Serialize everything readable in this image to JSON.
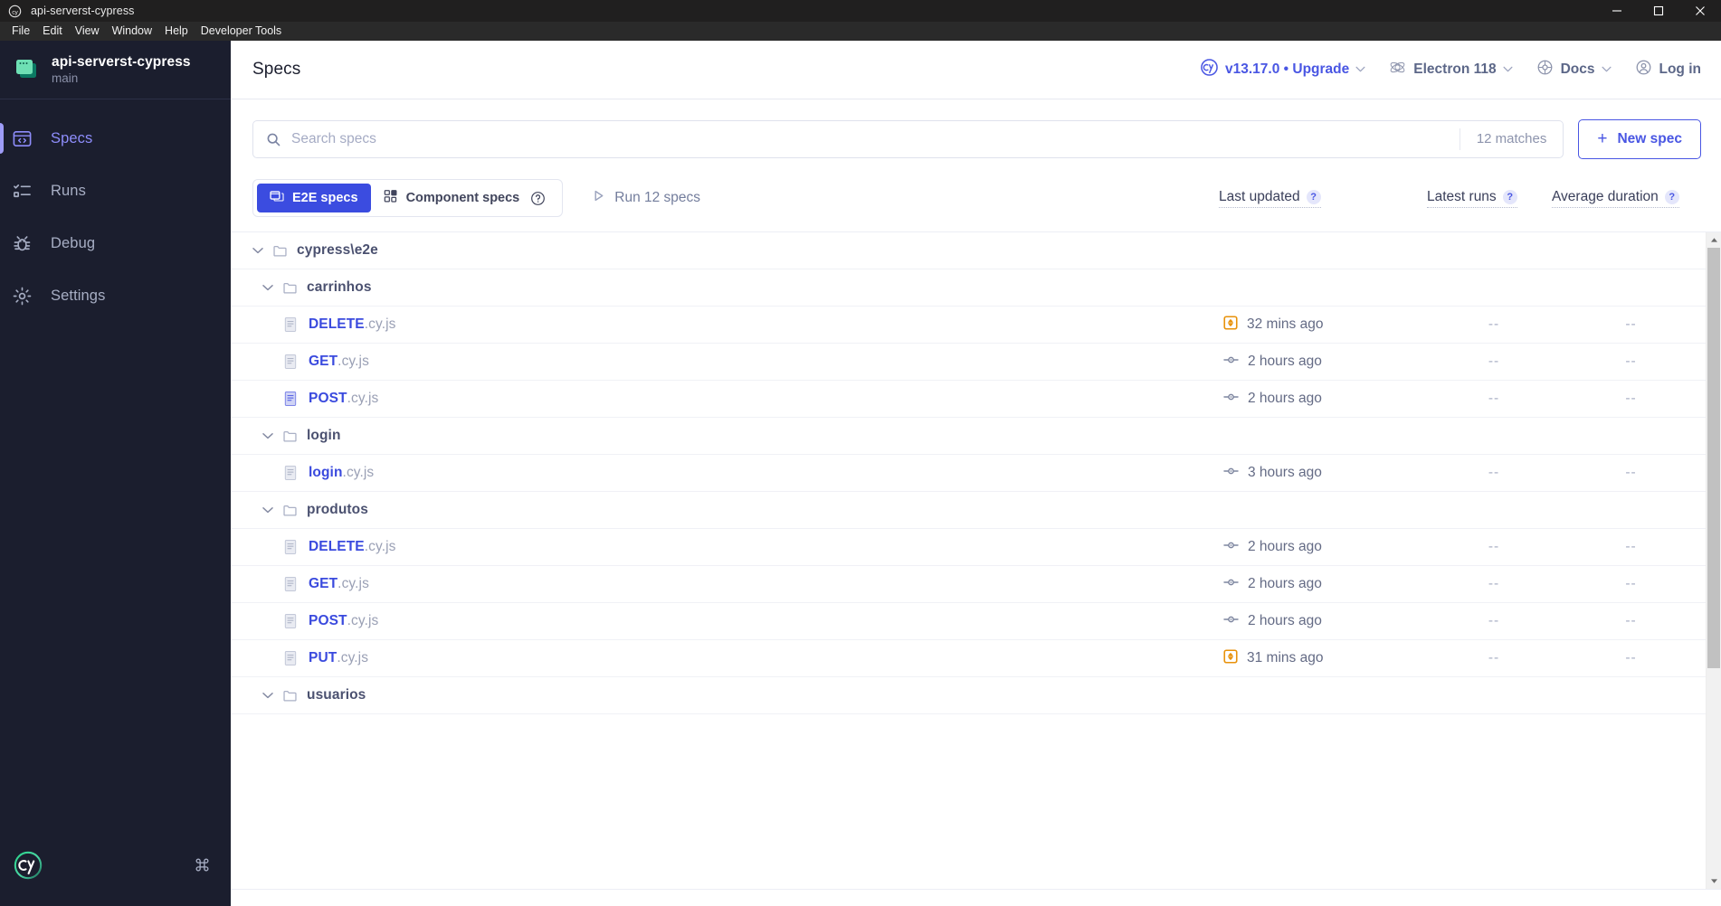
{
  "window": {
    "title": "api-serverst-cypress",
    "logo_icon": "cypress-logo-icon",
    "controls": [
      {
        "name": "minimize-button",
        "icon": "minimize-icon"
      },
      {
        "name": "maximize-button",
        "icon": "maximize-icon"
      },
      {
        "name": "close-button",
        "icon": "close-icon"
      }
    ]
  },
  "menubar": {
    "items": [
      {
        "label": "File"
      },
      {
        "label": "Edit"
      },
      {
        "label": "View"
      },
      {
        "label": "Window"
      },
      {
        "label": "Help"
      },
      {
        "label": "Developer Tools"
      }
    ]
  },
  "sidebar": {
    "project": {
      "name": "api-serverst-cypress",
      "branch": "main",
      "icon": "project-window-icon"
    },
    "items": [
      {
        "label": "Specs",
        "icon": "specs-code-window-icon",
        "active": true
      },
      {
        "label": "Runs",
        "icon": "runs-list-icon",
        "active": false
      },
      {
        "label": "Debug",
        "icon": "debug-bug-icon",
        "active": false
      },
      {
        "label": "Settings",
        "icon": "settings-gear-icon",
        "active": false
      }
    ],
    "footer": {
      "logo_icon": "cypress-cy-logo-icon",
      "shortcut_icon": "keyboard-command-icon"
    }
  },
  "header": {
    "title": "Specs",
    "links": [
      {
        "name": "version-upgrade",
        "icon": "cypress-badge-icon",
        "text": "v13.17.0 • Upgrade",
        "chevron": true,
        "accent": true
      },
      {
        "name": "browser-selector",
        "icon": "electron-icon",
        "text": "Electron 118",
        "chevron": true,
        "accent": false
      },
      {
        "name": "docs-menu",
        "icon": "docs-book-icon",
        "text": "Docs",
        "chevron": true,
        "accent": false
      },
      {
        "name": "login-button",
        "icon": "user-circle-icon",
        "text": "Log in",
        "chevron": false,
        "accent": false
      }
    ]
  },
  "search": {
    "icon": "search-icon",
    "placeholder": "Search specs",
    "value": "",
    "matches": "12 matches"
  },
  "new_spec": {
    "plus": "+",
    "label": "New spec"
  },
  "tabs": {
    "e2e": {
      "label": "E2E specs",
      "icon": "e2e-windows-icon",
      "active": true
    },
    "component": {
      "label": "Component specs",
      "icon": "component-blocks-icon",
      "help_icon": "help-circle-icon",
      "active": false
    },
    "run_all": {
      "label": "Run 12 specs",
      "icon": "play-triangle-icon"
    }
  },
  "columns": [
    {
      "label": "Last updated",
      "help": "?"
    },
    {
      "label": "Latest runs",
      "help": "?"
    },
    {
      "label": "Average duration",
      "help": "?"
    }
  ],
  "specs": [
    {
      "type": "dir",
      "depth": 1,
      "name": "cypress\\e2e",
      "expanded": true,
      "chevron": "chevron-down-icon",
      "icon": "folder-icon"
    },
    {
      "type": "dir",
      "depth": 2,
      "name": "carrinhos",
      "expanded": true,
      "chevron": "chevron-down-icon",
      "icon": "folder-icon"
    },
    {
      "type": "file",
      "depth": 3,
      "base": "DELETE",
      "ext": ".cy.js",
      "icon": "spec-file-icon",
      "status_icon": "modified-orange-icon",
      "updated": "32 mins ago",
      "latest_runs": "--",
      "avg_duration": "--"
    },
    {
      "type": "file",
      "depth": 3,
      "base": "GET",
      "ext": ".cy.js",
      "icon": "spec-file-icon",
      "status_icon": "git-commit-icon",
      "updated": "2 hours ago",
      "latest_runs": "--",
      "avg_duration": "--"
    },
    {
      "type": "file",
      "depth": 3,
      "base": "POST",
      "ext": ".cy.js",
      "icon": "spec-file-icon-highlighted",
      "status_icon": "git-commit-icon",
      "updated": "2 hours ago",
      "latest_runs": "--",
      "avg_duration": "--"
    },
    {
      "type": "dir",
      "depth": 2,
      "name": "login",
      "expanded": true,
      "chevron": "chevron-down-icon",
      "icon": "folder-icon"
    },
    {
      "type": "file",
      "depth": 3,
      "base": "login",
      "ext": ".cy.js",
      "icon": "spec-file-icon",
      "status_icon": "git-commit-icon",
      "updated": "3 hours ago",
      "latest_runs": "--",
      "avg_duration": "--"
    },
    {
      "type": "dir",
      "depth": 2,
      "name": "produtos",
      "expanded": true,
      "chevron": "chevron-down-icon",
      "icon": "folder-icon"
    },
    {
      "type": "file",
      "depth": 3,
      "base": "DELETE",
      "ext": ".cy.js",
      "icon": "spec-file-icon",
      "status_icon": "git-commit-icon",
      "updated": "2 hours ago",
      "latest_runs": "--",
      "avg_duration": "--"
    },
    {
      "type": "file",
      "depth": 3,
      "base": "GET",
      "ext": ".cy.js",
      "icon": "spec-file-icon",
      "status_icon": "git-commit-icon",
      "updated": "2 hours ago",
      "latest_runs": "--",
      "avg_duration": "--"
    },
    {
      "type": "file",
      "depth": 3,
      "base": "POST",
      "ext": ".cy.js",
      "icon": "spec-file-icon",
      "status_icon": "git-commit-icon",
      "updated": "2 hours ago",
      "latest_runs": "--",
      "avg_duration": "--"
    },
    {
      "type": "file",
      "depth": 3,
      "base": "PUT",
      "ext": ".cy.js",
      "icon": "spec-file-icon",
      "status_icon": "modified-orange-icon",
      "updated": "31 mins ago",
      "latest_runs": "--",
      "avg_duration": "--"
    },
    {
      "type": "dir",
      "depth": 2,
      "name": "usuarios",
      "expanded": true,
      "chevron": "chevron-down-icon",
      "icon": "folder-icon"
    }
  ],
  "colors": {
    "accent_blue": "#4956e3",
    "sidebar_bg": "#1b1e2e",
    "active_indicator": "#9e9cf7",
    "brand_green": "#44d2a4",
    "status_orange": "#e8920b",
    "titlebar_bg": "#201f1f"
  }
}
